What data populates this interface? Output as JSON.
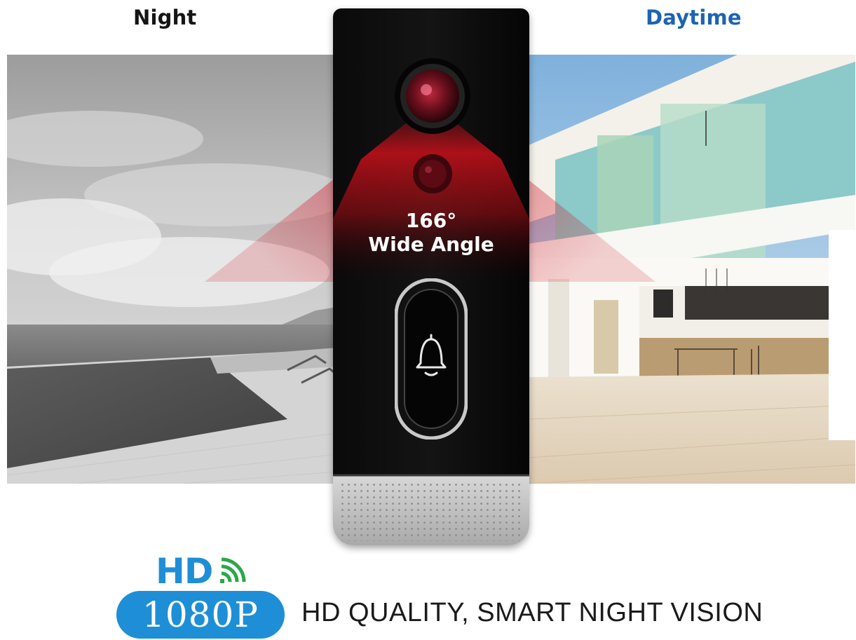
{
  "labels": {
    "night": "Night",
    "daytime": "Daytime"
  },
  "device": {
    "angle_value": "166°",
    "angle_label": "Wide Angle",
    "button_icon": "bell-icon",
    "camera_icon": "camera-lens-icon",
    "sensor_icon": "pir-sensor-icon"
  },
  "footer": {
    "hd_badge": "HD",
    "hd_icon": "wifi-signal-icon",
    "resolution": "1080P",
    "tagline": "HD QUALITY, SMART NIGHT VISION"
  },
  "colors": {
    "brand_blue": "#1e8fd6",
    "daytime_label": "#1d63b3",
    "beam_red": "#d0101e"
  }
}
